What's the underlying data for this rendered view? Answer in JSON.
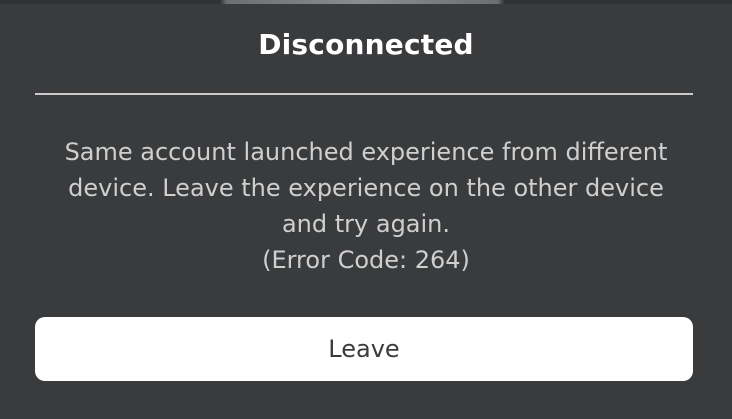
{
  "dialog": {
    "title": "Disconnected",
    "message_lines": [
      "Same account launched experience from different",
      "device. Leave the experience on the other device",
      "and try again.",
      "(Error Code: 264)"
    ],
    "leave_label": "Leave"
  },
  "colors": {
    "background": "#393b3d",
    "button": "#ffffff",
    "button_text": "#393b3d",
    "message_text": "#cfcfcf"
  }
}
